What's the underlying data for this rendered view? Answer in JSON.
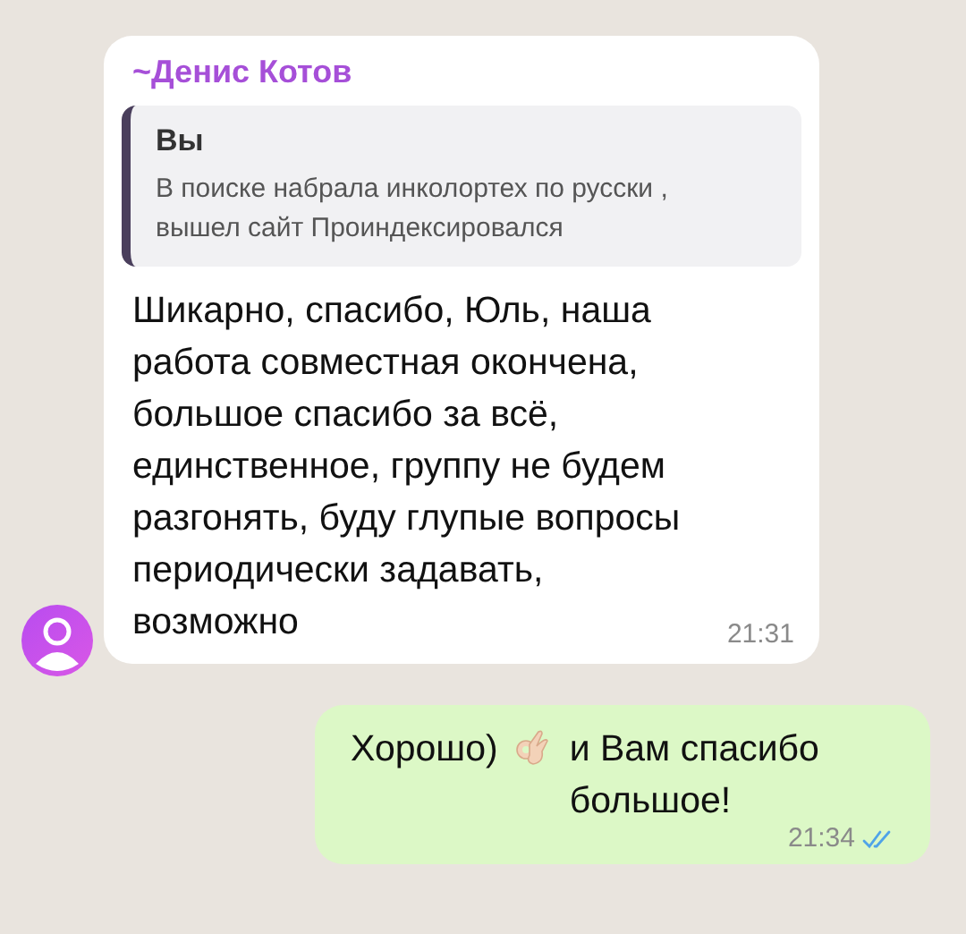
{
  "messages": [
    {
      "kind": "incoming",
      "sender": "~Денис Котов",
      "quote": {
        "author": "Вы",
        "text": "В поиске набрала инколортех по русски , вышел сайт Проиндексировался"
      },
      "text": "Шикарно, спасибо, Юль, наша работа совместная окончена, большое спасибо за всё, единственное, группу не будем разгонять, буду глупые вопросы периодически задавать, возможно",
      "time": "21:31"
    },
    {
      "kind": "outgoing",
      "text_before": "Хорошо)",
      "text_after": "и Вам спасибо большое!",
      "time": "21:34",
      "read": true
    }
  ]
}
